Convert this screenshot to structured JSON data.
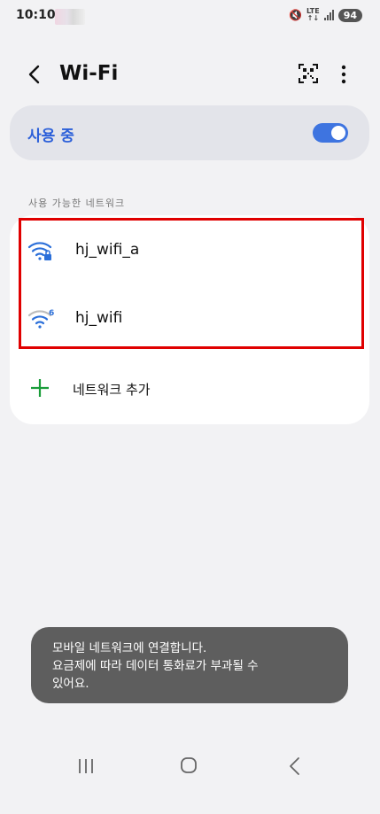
{
  "status_bar": {
    "time": "10:10",
    "network_type": "LTE",
    "battery": "94"
  },
  "header": {
    "title": "Wi-Fi",
    "back_icon": "chevron-left-icon",
    "qr_icon": "qr-code-icon",
    "more_icon": "more-vertical-icon"
  },
  "wifi_toggle": {
    "label": "사용 중",
    "state": "on"
  },
  "available_networks": {
    "section_label": "사용 가능한 네트워크",
    "items": [
      {
        "name": "hj_wifi_a",
        "icon": "wifi-locked-icon",
        "secured": true
      },
      {
        "name": "hj_wifi",
        "icon": "wifi-6-icon",
        "badge": "6"
      }
    ],
    "add_network_label": "네트워크 추가"
  },
  "toast": {
    "line1": "모바일 네트워크에 연결합니다.",
    "line2": "요금제에 따라 데이터 통화료가 부과될 수",
    "line3": "있어요."
  },
  "colors": {
    "accent": "#3e74e0",
    "highlight": "#e00000",
    "toast_bg": "#5e5e5e",
    "background": "#f2f2f4"
  }
}
